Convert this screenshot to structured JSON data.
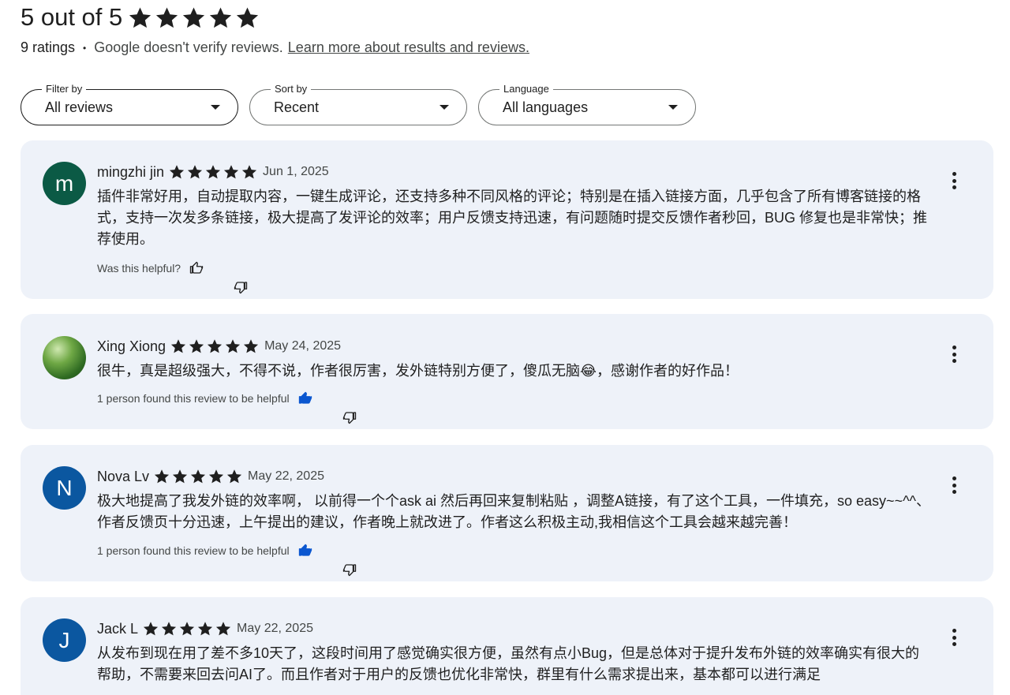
{
  "summary": {
    "rating_text": "5 out of 5",
    "rating_value": 5,
    "ratings_count": "9 ratings",
    "disclaimer": "Google doesn't verify reviews.",
    "learn_more": "Learn more about results and reviews."
  },
  "filters": {
    "filter_label": "Filter by",
    "filter_value": "All reviews",
    "sort_label": "Sort by",
    "sort_value": "Recent",
    "language_label": "Language",
    "language_value": "All languages"
  },
  "colors": {
    "star": "#1f1f1f",
    "card_bg": "#eef2f9",
    "helpful_blue": "#0b57d0"
  },
  "reviews": [
    {
      "initial": "m",
      "avatar_color": "#0b5a45",
      "name": "mingzhi jin",
      "stars": 5,
      "date": "Jun 1, 2025",
      "text": "插件非常好用，自动提取内容，一键生成评论，还支持多种不同风格的评论；特别是在插入链接方面，几乎包含了所有博客链接的格式，支持一次发多条链接，极大提高了发评论的效率；用户反馈支持迅速，有问题随时提交反馈作者秒回，BUG 修复也是非常快；推荐使用。",
      "helpful": "Was this helpful?",
      "thumbs_up_active": false
    },
    {
      "initial": "",
      "avatar_color": "#3f7d2a",
      "name": "Xing Xiong",
      "stars": 5,
      "date": "May 24, 2025",
      "text": "很牛，真是超级强大，不得不说，作者很厉害，发外链特别方便了，傻瓜无脑😂，感谢作者的好作品！",
      "helpful": "1 person found this review to be helpful",
      "thumbs_up_active": true
    },
    {
      "initial": "N",
      "avatar_color": "#0b57a0",
      "name": "Nova Lv",
      "stars": 5,
      "date": "May 22, 2025",
      "text": "极大地提高了我发外链的效率啊， 以前得一个个ask ai 然后再回来复制粘贴 ，调整A链接，有了这个工具，一件填充，so easy~~^^、作者反馈页十分迅速，上午提出的建议，作者晚上就改进了。作者这么积极主动,我相信这个工具会越来越完善！",
      "helpful": "1 person found this review to be helpful",
      "thumbs_up_active": true
    },
    {
      "initial": "J",
      "avatar_color": "#0b57a0",
      "name": "Jack L",
      "stars": 5,
      "date": "May 22, 2025",
      "text": "从发布到现在用了差不多10天了，这段时间用了感觉确实很方便，虽然有点小Bug，但是总体对于提升发布外链的效率确实有很大的帮助，不需要来回去问AI了。而且作者对于用户的反馈也优化非常快，群里有什么需求提出来，基本都可以进行满足",
      "helpful": "",
      "thumbs_up_active": false
    }
  ]
}
